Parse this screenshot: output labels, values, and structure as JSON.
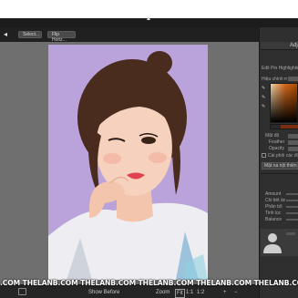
{
  "app": {
    "collapse_caret": "▲"
  },
  "toolbar": {
    "back_arrow": "◂",
    "buttons": [
      {
        "label": "Select..."
      },
      {
        "label": "Flip Horiz..."
      }
    ]
  },
  "right_panel": {
    "title": "Adj",
    "items": [
      "Edit Pin Highlighting",
      "Hiệu chỉnh màu",
      "Mật độ",
      "Feather",
      "Opacity",
      "Cài phối các điều chỉnh"
    ],
    "invert_button": "Mặt na nội thiện...",
    "sliders": [
      "Amount",
      "Chi tiết ảnh",
      "Phân bổ",
      "Tinh lọc",
      "Balance"
    ],
    "tool_glyphs": [
      "✎",
      "✎",
      "✎"
    ]
  },
  "statusbar": {
    "show_before": "Show Before",
    "zoom_label": "Zoom",
    "zoom_options": [
      "Fit",
      "1:1",
      "1:2"
    ],
    "plus": "+",
    "minus": "−",
    "ok": "OK"
  },
  "watermark": {
    "text": ".COM THELANB.COM THELANB.COM THELANB.COM THELANB.COM THELANB.COM THELANB.COM THELANB.COM THELANB.COM"
  },
  "colors": {
    "canvas_bg": "#6f6f6f",
    "photo_bg": "#b8a2d9",
    "panel_bg": "#2f2f2f",
    "accent_orange": "#d2691e"
  }
}
